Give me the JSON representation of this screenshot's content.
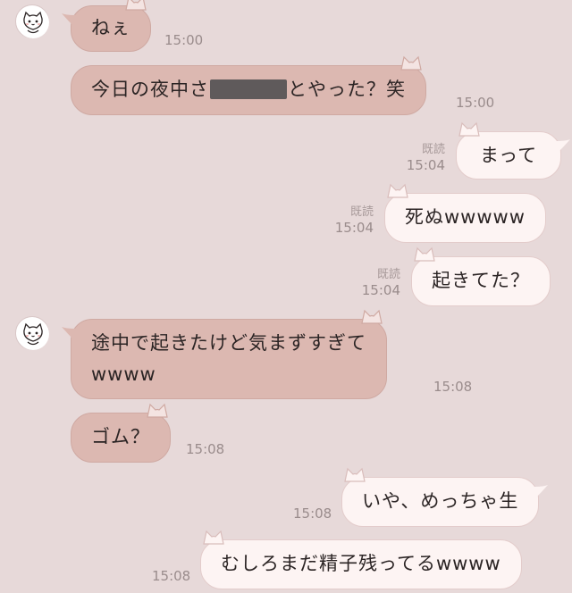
{
  "messages": [
    {
      "id": "m1",
      "side": "in",
      "text": "ねぇ",
      "time": "15:00",
      "avatar": "cat-avatar-icon"
    },
    {
      "id": "m2",
      "side": "in",
      "text_before": "今日の夜中さ",
      "redacted": true,
      "text_after": "とやった？笑",
      "time": "15:00"
    },
    {
      "id": "m3",
      "side": "out",
      "text": "まって",
      "read": "既読",
      "time": "15:04"
    },
    {
      "id": "m4",
      "side": "out",
      "text": "死ぬwwwww",
      "read": "既読",
      "time": "15:04"
    },
    {
      "id": "m5",
      "side": "out",
      "text": "起きてた？",
      "read": "既読",
      "time": "15:04"
    },
    {
      "id": "m6",
      "side": "in",
      "text_line1": "途中で起きたけど気まずすぎて",
      "text_line2": "wwww",
      "time": "15:08",
      "avatar": "cat-avatar-icon"
    },
    {
      "id": "m7",
      "side": "in",
      "text": "ゴム？",
      "time": "15:08"
    },
    {
      "id": "m8",
      "side": "out",
      "text": "いや、めっちゃ生",
      "time": "15:08"
    },
    {
      "id": "m9",
      "side": "out",
      "text": "むしろまだ精子残ってるwwww",
      "time": "15:08"
    }
  ],
  "colors": {
    "background": "#e7d9d9",
    "incoming_bubble": "#dcb8b1",
    "outgoing_bubble": "#fdf4f3",
    "meta_text": "#9a8c8c"
  }
}
